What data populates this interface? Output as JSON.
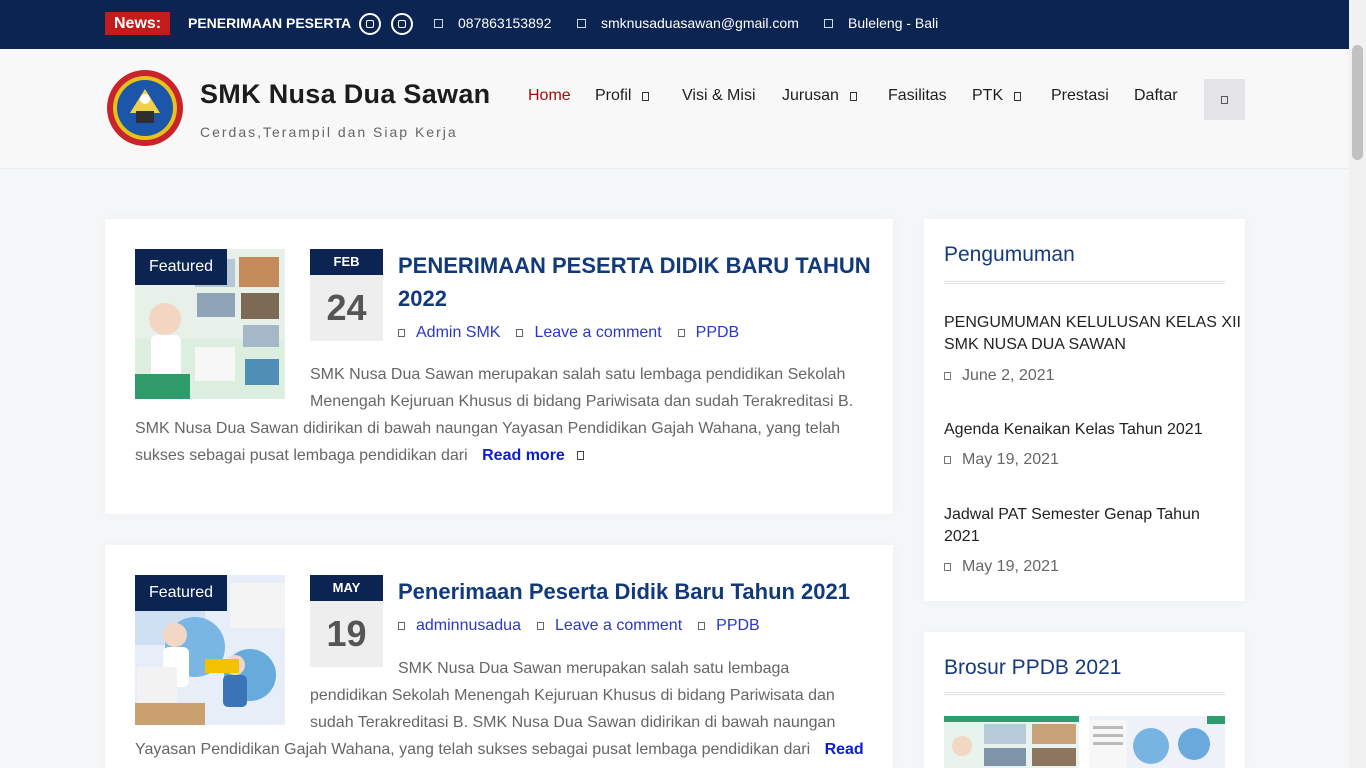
{
  "topbar": {
    "news_label": "News:",
    "news_text": "PENERIMAAN PESERTA",
    "phone": "087863153892",
    "email": "smknusaduasawan@gmail.com",
    "location": "Buleleng - Bali"
  },
  "header": {
    "site_title": "SMK Nusa Dua Sawan",
    "tagline": "Cerdas,Terampil dan Siap Kerja",
    "nav": {
      "home": "Home",
      "profil": "Profil",
      "visi": "Visi & Misi",
      "jurusan": "Jurusan",
      "fasilitas": "Fasilitas",
      "ptk": "PTK",
      "prestasi": "Prestasi",
      "daftar": "Daftar"
    }
  },
  "posts": [
    {
      "featured": "Featured",
      "month": "FEB",
      "day": "24",
      "title_line1": "PENERIMAAN PESERTA DIDIK BARU TAHUN",
      "title_line2": "2022",
      "author": "Admin SMK",
      "comment": "Leave a comment",
      "category": "PPDB",
      "excerpt_l1": "SMK Nusa Dua Sawan merupakan salah satu lembaga pendidikan Sekolah",
      "excerpt_l2": "Menengah Kejuruan Khusus di bidang Pariwisata dan sudah Terakreditasi B.",
      "excerpt_l3": "SMK Nusa Dua Sawan didirikan di bawah naungan Yayasan Pendidikan Gajah Wahana, yang telah",
      "excerpt_l4": "sukses sebagai pusat lembaga pendidikan dari",
      "read_more": "Read more"
    },
    {
      "featured": "Featured",
      "month": "MAY",
      "day": "19",
      "title": "Penerimaan Peserta Didik Baru Tahun 2021",
      "author": "adminnusadua",
      "comment": "Leave a comment",
      "category": "PPDB",
      "excerpt_l1": "SMK Nusa Dua Sawan merupakan salah satu lembaga",
      "excerpt_l2": "pendidikan Sekolah Menengah Kejuruan Khusus di bidang Pariwisata dan",
      "excerpt_l3": "sudah Terakreditasi B. SMK Nusa Dua Sawan didirikan di bawah naungan",
      "excerpt_l4": "Yayasan Pendidikan Gajah Wahana, yang telah sukses sebagai pusat lembaga pendidikan dari",
      "read_more": "Read"
    }
  ],
  "sidebar": {
    "pengumuman": {
      "title": "Pengumuman",
      "items": [
        {
          "title_l1": "PENGUMUMAN KELULUSAN KELAS XII",
          "title_l2": "SMK NUSA DUA SAWAN",
          "date": "June 2, 2021"
        },
        {
          "title_l1": "Agenda Kenaikan Kelas Tahun 2021",
          "title_l2": "",
          "date": "May 19, 2021"
        },
        {
          "title_l1": "Jadwal PAT Semester Genap Tahun",
          "title_l2": "2021",
          "date": "May 19, 2021"
        }
      ]
    },
    "brosur": {
      "title": "Brosur PPDB 2021"
    }
  },
  "colors": {
    "navy": "#0c2452",
    "accent_red": "#c41c1c",
    "link_blue": "#2a37c9",
    "title_blue": "#123a7a"
  }
}
